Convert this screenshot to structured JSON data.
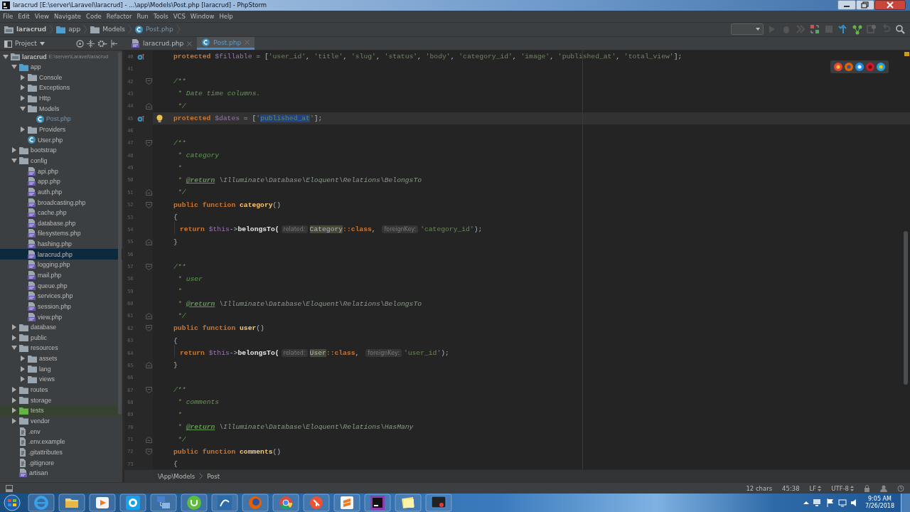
{
  "window": {
    "title": "laracrud [E:\\server\\Laravel\\laracrud] - ...\\app\\Models\\Post.php [laracrud] - PhpStorm"
  },
  "menu": [
    "File",
    "Edit",
    "View",
    "Navigate",
    "Code",
    "Refactor",
    "Run",
    "Tools",
    "VCS",
    "Window",
    "Help"
  ],
  "nav_path": [
    {
      "label": "laracrud",
      "kind": "module"
    },
    {
      "label": "app",
      "kind": "source"
    },
    {
      "label": "Models",
      "kind": "folder"
    },
    {
      "label": "Post.php",
      "kind": "class"
    }
  ],
  "project_panel": {
    "title": "Project"
  },
  "tabs": [
    {
      "label": "laracrud.php",
      "kind": "php",
      "selected": false
    },
    {
      "label": "Post.php",
      "kind": "class",
      "selected": true
    }
  ],
  "tree": [
    {
      "label": "laracrud",
      "path": "E:\\server\\Laravel\\laracrud",
      "kind": "module",
      "expanded": true,
      "selected": false,
      "modified": false,
      "children": [
        {
          "label": "app",
          "kind": "source",
          "expanded": true,
          "selected": false,
          "modified": false,
          "children": [
            {
              "label": "Console",
              "kind": "folder",
              "expanded": false,
              "selected": false,
              "modified": false
            },
            {
              "label": "Exceptions",
              "kind": "folder",
              "expanded": false,
              "selected": false,
              "modified": false
            },
            {
              "label": "Http",
              "kind": "folder",
              "expanded": false,
              "selected": false,
              "modified": false
            },
            {
              "label": "Models",
              "kind": "folder",
              "expanded": true,
              "selected": false,
              "modified": false,
              "children": [
                {
                  "label": "Post.php",
                  "kind": "class",
                  "selected": false,
                  "modified": true
                }
              ]
            },
            {
              "label": "Providers",
              "kind": "folder",
              "expanded": false,
              "selected": false,
              "modified": false
            },
            {
              "label": "User.php",
              "kind": "class",
              "selected": false,
              "modified": false
            }
          ]
        },
        {
          "label": "bootstrap",
          "kind": "folder",
          "expanded": false,
          "selected": false,
          "modified": false
        },
        {
          "label": "config",
          "kind": "folder",
          "expanded": true,
          "selected": false,
          "modified": false,
          "children": [
            {
              "label": "api.php",
              "kind": "php",
              "selected": false,
              "modified": false
            },
            {
              "label": "app.php",
              "kind": "php",
              "selected": false,
              "modified": false
            },
            {
              "label": "auth.php",
              "kind": "php",
              "selected": false,
              "modified": false
            },
            {
              "label": "broadcasting.php",
              "kind": "php",
              "selected": false,
              "modified": false
            },
            {
              "label": "cache.php",
              "kind": "php",
              "selected": false,
              "modified": false
            },
            {
              "label": "database.php",
              "kind": "php",
              "selected": false,
              "modified": false
            },
            {
              "label": "filesystems.php",
              "kind": "php",
              "selected": false,
              "modified": false
            },
            {
              "label": "hashing.php",
              "kind": "php",
              "selected": false,
              "modified": false
            },
            {
              "label": "laracrud.php",
              "kind": "php",
              "selected": true,
              "modified": false
            },
            {
              "label": "logging.php",
              "kind": "php",
              "selected": false,
              "modified": false
            },
            {
              "label": "mail.php",
              "kind": "php",
              "selected": false,
              "modified": false
            },
            {
              "label": "queue.php",
              "kind": "php",
              "selected": false,
              "modified": false
            },
            {
              "label": "services.php",
              "kind": "php",
              "selected": false,
              "modified": false
            },
            {
              "label": "session.php",
              "kind": "php",
              "selected": false,
              "modified": false
            },
            {
              "label": "view.php",
              "kind": "php",
              "selected": false,
              "modified": false
            }
          ]
        },
        {
          "label": "database",
          "kind": "folder",
          "expanded": false,
          "selected": false,
          "modified": false
        },
        {
          "label": "public",
          "kind": "folder",
          "expanded": false,
          "selected": false,
          "modified": false
        },
        {
          "label": "resources",
          "kind": "folder",
          "expanded": true,
          "selected": false,
          "modified": false,
          "children": [
            {
              "label": "assets",
              "kind": "folder",
              "expanded": false,
              "selected": false,
              "modified": false
            },
            {
              "label": "lang",
              "kind": "folder",
              "expanded": false,
              "selected": false,
              "modified": false
            },
            {
              "label": "views",
              "kind": "folder",
              "expanded": false,
              "selected": false,
              "modified": false
            }
          ]
        },
        {
          "label": "routes",
          "kind": "folder",
          "expanded": false,
          "selected": false,
          "modified": false
        },
        {
          "label": "storage",
          "kind": "folder",
          "expanded": false,
          "selected": false,
          "modified": false
        },
        {
          "label": "tests",
          "kind": "test",
          "expanded": false,
          "selected": false,
          "modified": false
        },
        {
          "label": "vendor",
          "kind": "folder",
          "expanded": false,
          "selected": false,
          "modified": false
        },
        {
          "label": ".env",
          "kind": "file",
          "selected": false,
          "modified": false
        },
        {
          "label": ".env.example",
          "kind": "file",
          "selected": false,
          "modified": false
        },
        {
          "label": ".gitattributes",
          "kind": "file",
          "selected": false,
          "modified": false
        },
        {
          "label": ".gitignore",
          "kind": "file",
          "selected": false,
          "modified": false
        },
        {
          "label": "artisan",
          "kind": "php",
          "selected": false,
          "modified": false
        }
      ]
    }
  ],
  "editor": {
    "lines": [
      {
        "number": "40",
        "kind": "code",
        "current": false,
        "gutter": [
          {
            "kind": "override"
          }
        ],
        "tokens": [
          {
            "text": "protected ",
            "kind": "kw"
          },
          {
            "text": "$fillable",
            "kind": "var"
          },
          {
            "text": " = [",
            "kind": "plain"
          },
          {
            "text": "'user_id'",
            "kind": "str"
          },
          {
            "text": ", ",
            "kind": "plain"
          },
          {
            "text": "'title'",
            "kind": "str"
          },
          {
            "text": ", ",
            "kind": "plain"
          },
          {
            "text": "'slug'",
            "kind": "str"
          },
          {
            "text": ", ",
            "kind": "plain"
          },
          {
            "text": "'status'",
            "kind": "str"
          },
          {
            "text": ", ",
            "kind": "plain"
          },
          {
            "text": "'body'",
            "kind": "str"
          },
          {
            "text": ", ",
            "kind": "plain"
          },
          {
            "text": "'category_id'",
            "kind": "str"
          },
          {
            "text": ", ",
            "kind": "plain"
          },
          {
            "text": "'image'",
            "kind": "str"
          },
          {
            "text": ", ",
            "kind": "plain"
          },
          {
            "text": "'published_at'",
            "kind": "str"
          },
          {
            "text": ", ",
            "kind": "plain"
          },
          {
            "text": "'total_view'",
            "kind": "str"
          },
          {
            "text": "];",
            "kind": "plain"
          }
        ]
      },
      {
        "number": "41",
        "kind": "code",
        "current": false
      },
      {
        "number": "42",
        "kind": "code",
        "current": false,
        "gutter": [
          {
            "kind": "fold-start"
          }
        ],
        "tokens": [
          {
            "text": "/**",
            "kind": "comment"
          }
        ]
      },
      {
        "number": "43",
        "kind": "doc",
        "current": false,
        "tokens": [
          {
            "text": "* Date time columns.",
            "kind": "comment"
          }
        ]
      },
      {
        "number": "44",
        "kind": "doc",
        "current": false,
        "gutter": [
          {
            "kind": "fold-end"
          }
        ],
        "tokens": [
          {
            "text": "*/",
            "kind": "comment"
          }
        ]
      },
      {
        "number": "45",
        "kind": "code",
        "current": true,
        "gutter": [
          {
            "kind": "override"
          },
          {
            "kind": "bulb"
          }
        ],
        "tokens": [
          {
            "text": "protected ",
            "kind": "kw"
          },
          {
            "text": "$dates",
            "kind": "var"
          },
          {
            "text": " = [",
            "kind": "plain"
          },
          {
            "text": "'",
            "kind": "str"
          },
          {
            "text": "published_at",
            "kind": "selected"
          },
          {
            "text": "'",
            "kind": "str"
          },
          {
            "text": "];",
            "kind": "plain"
          }
        ]
      },
      {
        "number": "46",
        "kind": "code",
        "current": false
      },
      {
        "number": "47",
        "kind": "code",
        "current": false,
        "gutter": [
          {
            "kind": "fold-start"
          }
        ],
        "tokens": [
          {
            "text": "/**",
            "kind": "comment"
          }
        ]
      },
      {
        "number": "48",
        "kind": "doc",
        "current": false,
        "tokens": [
          {
            "text": "* category",
            "kind": "comment"
          }
        ]
      },
      {
        "number": "49",
        "kind": "doc",
        "current": false,
        "tokens": [
          {
            "text": "*",
            "kind": "comment"
          }
        ]
      },
      {
        "number": "50",
        "kind": "doc",
        "current": false,
        "tokens": [
          {
            "text": "* ",
            "kind": "comment"
          },
          {
            "text": "@return",
            "kind": "doctag"
          },
          {
            "text": " \\Illuminate\\Database\\Eloquent\\Relations\\BelongsTo",
            "kind": "doctype"
          }
        ]
      },
      {
        "number": "51",
        "kind": "doc",
        "current": false,
        "gutter": [
          {
            "kind": "fold-end"
          }
        ],
        "tokens": [
          {
            "text": "*/",
            "kind": "comment"
          }
        ]
      },
      {
        "number": "52",
        "kind": "code",
        "current": false,
        "gutter": [
          {
            "kind": "fold-start"
          }
        ],
        "tokens": [
          {
            "text": "public function ",
            "kind": "kw"
          },
          {
            "text": "category",
            "kind": "fn"
          },
          {
            "text": "()",
            "kind": "plain"
          }
        ]
      },
      {
        "number": "53",
        "kind": "code",
        "current": false,
        "tokens": [
          {
            "text": "{",
            "kind": "plain"
          }
        ]
      },
      {
        "number": "54",
        "kind": "body",
        "current": false,
        "tokens": [
          {
            "text": "return ",
            "kind": "kw"
          },
          {
            "text": "$this",
            "kind": "var"
          },
          {
            "text": "->",
            "kind": "plain"
          },
          {
            "text": "belongsTo(",
            "kind": "call"
          },
          {
            "text": "related:",
            "kind": "hint"
          },
          {
            "text": "Category",
            "kind": "usage"
          },
          {
            "text": "::class",
            "kind": "kw"
          },
          {
            "text": ", ",
            "kind": "plain"
          },
          {
            "text": "foreignKey:",
            "kind": "hint"
          },
          {
            "text": "'category_id'",
            "kind": "str"
          },
          {
            "text": ");",
            "kind": "plain"
          }
        ]
      },
      {
        "number": "55",
        "kind": "code",
        "current": false,
        "gutter": [
          {
            "kind": "fold-end"
          }
        ],
        "tokens": [
          {
            "text": "}",
            "kind": "plain"
          }
        ]
      },
      {
        "number": "56",
        "kind": "code",
        "current": false
      },
      {
        "number": "57",
        "kind": "code",
        "current": false,
        "gutter": [
          {
            "kind": "fold-start"
          }
        ],
        "tokens": [
          {
            "text": "/**",
            "kind": "comment"
          }
        ]
      },
      {
        "number": "58",
        "kind": "doc",
        "current": false,
        "tokens": [
          {
            "text": "* user",
            "kind": "comment"
          }
        ]
      },
      {
        "number": "59",
        "kind": "doc",
        "current": false,
        "tokens": [
          {
            "text": "*",
            "kind": "comment"
          }
        ]
      },
      {
        "number": "60",
        "kind": "doc",
        "current": false,
        "tokens": [
          {
            "text": "* ",
            "kind": "comment"
          },
          {
            "text": "@return",
            "kind": "doctag"
          },
          {
            "text": " \\Illuminate\\Database\\Eloquent\\Relations\\BelongsTo",
            "kind": "doctype"
          }
        ]
      },
      {
        "number": "61",
        "kind": "doc",
        "current": false,
        "gutter": [
          {
            "kind": "fold-end"
          }
        ],
        "tokens": [
          {
            "text": "*/",
            "kind": "comment"
          }
        ]
      },
      {
        "number": "62",
        "kind": "code",
        "current": false,
        "gutter": [
          {
            "kind": "fold-start"
          }
        ],
        "tokens": [
          {
            "text": "public function ",
            "kind": "kw"
          },
          {
            "text": "user",
            "kind": "fn"
          },
          {
            "text": "()",
            "kind": "plain"
          }
        ]
      },
      {
        "number": "63",
        "kind": "code",
        "current": false,
        "tokens": [
          {
            "text": "{",
            "kind": "plain"
          }
        ]
      },
      {
        "number": "64",
        "kind": "body",
        "current": false,
        "tokens": [
          {
            "text": "return ",
            "kind": "kw"
          },
          {
            "text": "$this",
            "kind": "var"
          },
          {
            "text": "->",
            "kind": "plain"
          },
          {
            "text": "belongsTo(",
            "kind": "call"
          },
          {
            "text": "related:",
            "kind": "hint"
          },
          {
            "text": "User",
            "kind": "usage"
          },
          {
            "text": "::class",
            "kind": "kw"
          },
          {
            "text": ", ",
            "kind": "plain"
          },
          {
            "text": "foreignKey:",
            "kind": "hint"
          },
          {
            "text": "'user_id'",
            "kind": "str"
          },
          {
            "text": ");",
            "kind": "plain"
          }
        ]
      },
      {
        "number": "65",
        "kind": "code",
        "current": false,
        "gutter": [
          {
            "kind": "fold-end"
          }
        ],
        "tokens": [
          {
            "text": "}",
            "kind": "plain"
          }
        ]
      },
      {
        "number": "66",
        "kind": "code",
        "current": false
      },
      {
        "number": "67",
        "kind": "code",
        "current": false,
        "gutter": [
          {
            "kind": "fold-start"
          }
        ],
        "tokens": [
          {
            "text": "/**",
            "kind": "comment"
          }
        ]
      },
      {
        "number": "68",
        "kind": "doc",
        "current": false,
        "tokens": [
          {
            "text": "* comments",
            "kind": "comment"
          }
        ]
      },
      {
        "number": "69",
        "kind": "doc",
        "current": false,
        "tokens": [
          {
            "text": "*",
            "kind": "comment"
          }
        ]
      },
      {
        "number": "70",
        "kind": "doc",
        "current": false,
        "tokens": [
          {
            "text": "* ",
            "kind": "comment"
          },
          {
            "text": "@return",
            "kind": "doctag"
          },
          {
            "text": " \\Illuminate\\Database\\Eloquent\\Relations\\HasMany",
            "kind": "doctype"
          }
        ]
      },
      {
        "number": "71",
        "kind": "doc",
        "current": false,
        "gutter": [
          {
            "kind": "fold-end"
          }
        ],
        "tokens": [
          {
            "text": "*/",
            "kind": "comment"
          }
        ]
      },
      {
        "number": "72",
        "kind": "code",
        "current": false,
        "gutter": [
          {
            "kind": "fold-start"
          }
        ],
        "tokens": [
          {
            "text": "public function ",
            "kind": "kw"
          },
          {
            "text": "comments",
            "kind": "fn"
          },
          {
            "text": "()",
            "kind": "plain"
          }
        ]
      },
      {
        "number": "73",
        "kind": "code",
        "current": false,
        "tokens": [
          {
            "text": "{",
            "kind": "plain"
          }
        ]
      }
    ]
  },
  "breadcrumb": [
    "\\App\\Models",
    "Post"
  ],
  "status_bar": {
    "selection": "12 chars",
    "position": "45:38",
    "line_ending": "LF",
    "encoding": "UTF-8"
  },
  "taskbar": {
    "time": "9:05 AM",
    "date": "7/26/2018"
  }
}
